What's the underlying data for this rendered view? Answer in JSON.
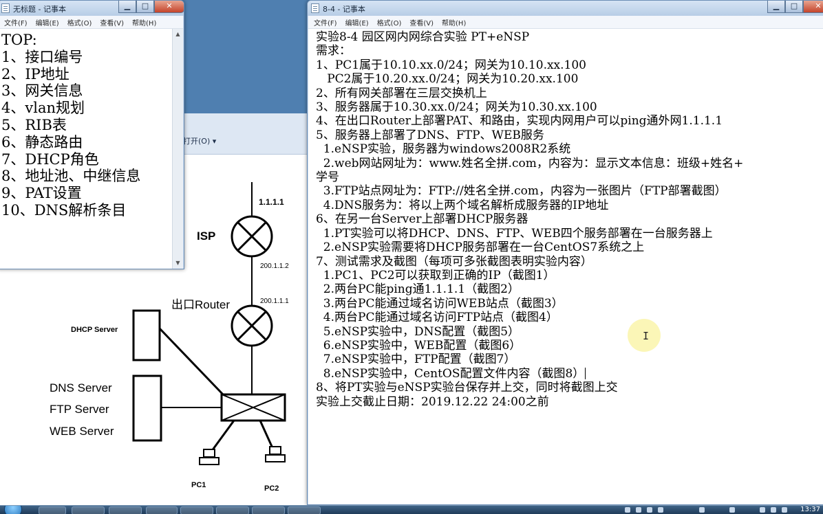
{
  "background_window": {
    "open_menu": "打开(O)",
    "diagram": {
      "isp_label": "ISP",
      "isp_ip": "1.1.1.1",
      "link_ip_top": "200.1.1.2",
      "link_ip_bottom": "200.1.1.1",
      "router_label": "出口Router",
      "dhcp_label": "DHCP Server",
      "dns_label": "DNS Server",
      "ftp_label": "FTP Server",
      "web_label": "WEB Server",
      "pc1_label": "PC1",
      "pc2_label": "PC2"
    }
  },
  "notepad_small": {
    "title": "无标题 - 记事本",
    "menu": [
      "文件(F)",
      "编辑(E)",
      "格式(O)",
      "查看(V)",
      "帮助(H)"
    ],
    "lines": [
      "TOP:",
      "1、接口编号",
      "2、IP地址",
      "3、网关信息",
      "4、vlan规划",
      "5、RIB表",
      "6、静态路由",
      "7、DHCP角色",
      "8、地址池、中继信息",
      "9、PAT设置",
      "10、DNS解析条目"
    ]
  },
  "notepad_big": {
    "title": "8-4 - 记事本",
    "menu": [
      "文件(F)",
      "编辑(E)",
      "格式(O)",
      "查看(V)",
      "帮助(H)"
    ],
    "lines": [
      "实验8-4 园区网内网综合实验 PT+eNSP",
      "需求：",
      "1、PC1属于10.10.xx.0/24；网关为10.10.xx.100",
      "   PC2属于10.20.xx.0/24；网关为10.20.xx.100",
      "2、所有网关部署在三层交换机上",
      "3、服务器属于10.30.xx.0/24；网关为10.30.xx.100",
      "4、在出口Router上部署PAT、和路由，实现内网用户可以ping通外网1.1.1.1",
      "5、服务器上部署了DNS、FTP、WEB服务",
      "  1.eNSP实验，服务器为windows2008R2系统",
      "  2.web网站网址为：www.姓名全拼.com，内容为：显示文本信息：班级+姓名+",
      "学号",
      "  3.FTP站点网址为：FTP://姓名全拼.com，内容为一张图片（FTP部署截图）",
      "  4.DNS服务为：将以上两个域名解析成服务器的IP地址",
      "6、在另一台Server上部署DHCP服务器",
      "  1.PT实验可以将DHCP、DNS、FTP、WEB四个服务部署在一台服务器上",
      "  2.eNSP实验需要将DHCP服务部署在一台CentOS7系统之上",
      "7、测试需求及截图（每项可多张截图表明实验内容）",
      "  1.PC1、PC2可以获取到正确的IP（截图1）",
      "  2.两台PC能ping通1.1.1.1（截图2）",
      "  3.两台PC能通过域名访问WEB站点（截图3）",
      "  4.两台PC能通过域名访问FTP站点（截图4）",
      "  5.eNSP实验中，DNS配置（截图5）",
      "  6.eNSP实验中，WEB配置（截图6）",
      "  7.eNSP实验中，FTP配置（截图7）",
      "  8.eNSP实验中，CentOS配置文件内容（截图8）",
      "8、将PT实验与eNSP实验台保存并上交，同时将截图上交",
      "实验上交截止日期：2019.12.22 24:00之前"
    ]
  },
  "taskbar": {
    "clock": "13:37"
  },
  "colors": {
    "desktop": "#4f7fb0",
    "titlebar": "#c9daee",
    "close_button": "#c5432a",
    "cursor_highlight": "#faf5aa"
  }
}
